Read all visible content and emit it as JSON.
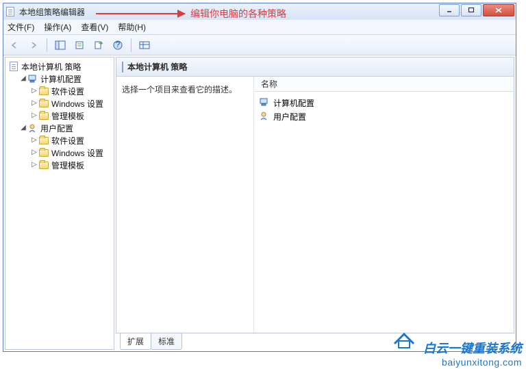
{
  "window": {
    "title": "本地组策略编辑器"
  },
  "annotation": {
    "text": "编辑你电脑的各种策略"
  },
  "menu": {
    "file": "文件(F)",
    "action": "操作(A)",
    "view": "查看(V)",
    "help": "帮助(H)"
  },
  "tree": {
    "root": "本地计算机 策略",
    "computer": {
      "label": "计算机配置",
      "software": "软件设置",
      "windows": "Windows 设置",
      "templates": "管理模板"
    },
    "user": {
      "label": "用户配置",
      "software": "软件设置",
      "windows": "Windows 设置",
      "templates": "管理模板"
    }
  },
  "content": {
    "header": "本地计算机 策略",
    "prompt": "选择一个项目来查看它的描述。",
    "col_name": "名称",
    "items": {
      "computer": "计算机配置",
      "user": "用户配置"
    }
  },
  "tabs": {
    "extended": "扩展",
    "standard": "标准"
  },
  "watermark": {
    "cn": "白云一键重装系统",
    "en": "baiyunxitong.com"
  }
}
